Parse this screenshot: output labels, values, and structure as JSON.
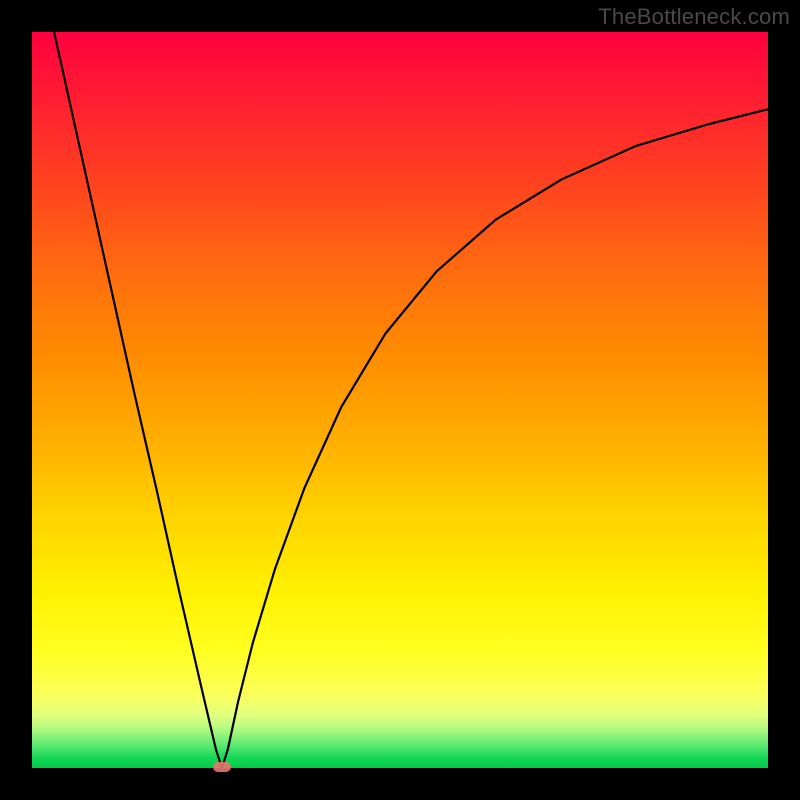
{
  "watermark": "TheBottleneck.com",
  "chart_data": {
    "type": "line",
    "title": "",
    "xlabel": "",
    "ylabel": "",
    "xlim": [
      0,
      100
    ],
    "ylim": [
      0,
      100
    ],
    "grid": false,
    "points": [
      {
        "x": 3.0,
        "y": 100.0
      },
      {
        "x": 5.0,
        "y": 91.0
      },
      {
        "x": 8.0,
        "y": 77.5
      },
      {
        "x": 11.0,
        "y": 64.0
      },
      {
        "x": 14.0,
        "y": 50.5
      },
      {
        "x": 17.0,
        "y": 37.5
      },
      {
        "x": 20.0,
        "y": 24.0
      },
      {
        "x": 23.0,
        "y": 11.0
      },
      {
        "x": 25.0,
        "y": 2.5
      },
      {
        "x": 25.8,
        "y": 0.0
      },
      {
        "x": 26.6,
        "y": 2.5
      },
      {
        "x": 28.0,
        "y": 9.0
      },
      {
        "x": 30.0,
        "y": 17.0
      },
      {
        "x": 33.0,
        "y": 27.0
      },
      {
        "x": 37.0,
        "y": 38.0
      },
      {
        "x": 42.0,
        "y": 49.0
      },
      {
        "x": 48.0,
        "y": 59.0
      },
      {
        "x": 55.0,
        "y": 67.5
      },
      {
        "x": 63.0,
        "y": 74.5
      },
      {
        "x": 72.0,
        "y": 80.0
      },
      {
        "x": 82.0,
        "y": 84.5
      },
      {
        "x": 92.0,
        "y": 87.5
      },
      {
        "x": 100.0,
        "y": 89.5
      }
    ],
    "marker": {
      "x": 25.8,
      "y": 0.2,
      "color": "#e8766f"
    },
    "background_gradient": {
      "top_color": "#ff0040",
      "bottom_color": "#00cc44"
    }
  }
}
